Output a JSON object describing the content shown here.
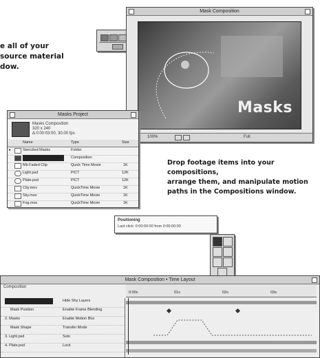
{
  "callouts": {
    "import_line1": "e all of your",
    "import_line2": "source material",
    "import_line3": "dow.",
    "drop_line1": "Drop footage items into your compositions,",
    "drop_line2": "arrange them, and manipulate motion",
    "drop_line3": "paths in the Compositions window."
  },
  "composition_window": {
    "title": "Mask Composition",
    "overlay_text": "Masks",
    "status_zoom": "100%",
    "status_res": "Full"
  },
  "project_window": {
    "title": "Masks Project",
    "info_name": "Masks Composition",
    "info_line2": "320 x 240",
    "info_line3": "Δ 0:00:03:00, 30.00 fps",
    "columns": [
      "Name",
      "Type",
      "Size"
    ],
    "items": [
      {
        "name": "Stenciled Masks",
        "type": "Folder",
        "size": ""
      },
      {
        "name": "Masks Composition",
        "type": "Composition",
        "size": ""
      },
      {
        "name": "Mb Faded Clip",
        "type": "Quick Time Movie",
        "size": "1K"
      },
      {
        "name": "Light.psd",
        "type": "PICT",
        "size": "12K"
      },
      {
        "name": "Plate.psd",
        "type": "PICT",
        "size": "12K"
      },
      {
        "name": "City.mov",
        "type": "QuickTime Movie",
        "size": "1K"
      },
      {
        "name": "Sky.mov",
        "type": "QuickTime Movie",
        "size": "1K"
      },
      {
        "name": "Fog.mov",
        "type": "QuickTime Movie",
        "size": "1K"
      }
    ]
  },
  "tooltip_popup": {
    "line1": "Positioning",
    "line2": "Last click: 0:00:00:00 from 0:00:00:00"
  },
  "timeline_window": {
    "title": "Mask Composition • Time Layout",
    "left_header": "Composition",
    "layers": [
      {
        "name": "1. Masks",
        "switch": "Hide Shy Layers"
      },
      {
        "name": "Mask Position",
        "switch": "Enable Frame Blending"
      },
      {
        "name": "2. Masks",
        "switch": "Enable Motion Blur"
      },
      {
        "name": "Mask Shape",
        "switch": "Transfer Mode"
      },
      {
        "name": "3. Light.psd",
        "switch": "Solo"
      },
      {
        "name": "4. Plate.psd",
        "switch": "Lock"
      }
    ],
    "ruler_marks": [
      "0:00s",
      "01s",
      "02s",
      "03s"
    ]
  },
  "colors": {
    "window_bg": "#e8e8e8",
    "titlebar": "#cfcfcf",
    "selection": "#222222",
    "comp_canvas": "#6a6a6a"
  }
}
